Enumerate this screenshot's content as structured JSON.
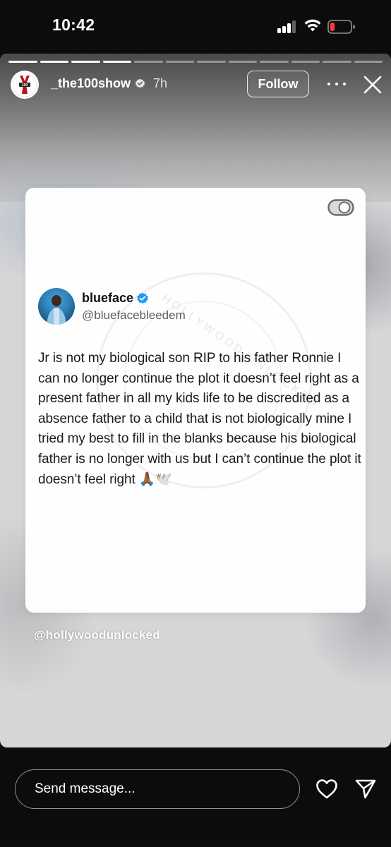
{
  "status_bar": {
    "time": "10:42",
    "signal_icon": "cellular-signal-icon",
    "wifi_icon": "wifi-icon",
    "battery_icon": "battery-icon",
    "battery_color": "#ff3b30"
  },
  "story": {
    "progress_segments_total": 12,
    "progress_segments_done": 4,
    "account": {
      "username": "_the100show",
      "verified": true,
      "time_ago": "7h"
    },
    "follow_label": "Follow",
    "more_icon": "more-horizontal-icon",
    "close_icon": "close-icon",
    "tweet": {
      "name": "blueface",
      "handle": "@bluefacebleedem",
      "verified_color": "#1d9bf0",
      "text": "Jr is not my biological son RIP to his father Ronnie I can no longer continue the plot it doesn’t feel right as a present father in all my kids life to be discredited as a absence father to a child that is not biologically mine I tried my best to fill in the blanks because his biological father is no longer with us but I can’t continue the plot it doesn’t feel right 🙏🏾🕊️",
      "watermark": "HOLLYWOOD UNLOCKED"
    },
    "credit": "@hollywoodunlocked"
  },
  "bottom_bar": {
    "message_placeholder": "Send message...",
    "heart_icon": "heart-icon",
    "send_icon": "send-icon"
  }
}
